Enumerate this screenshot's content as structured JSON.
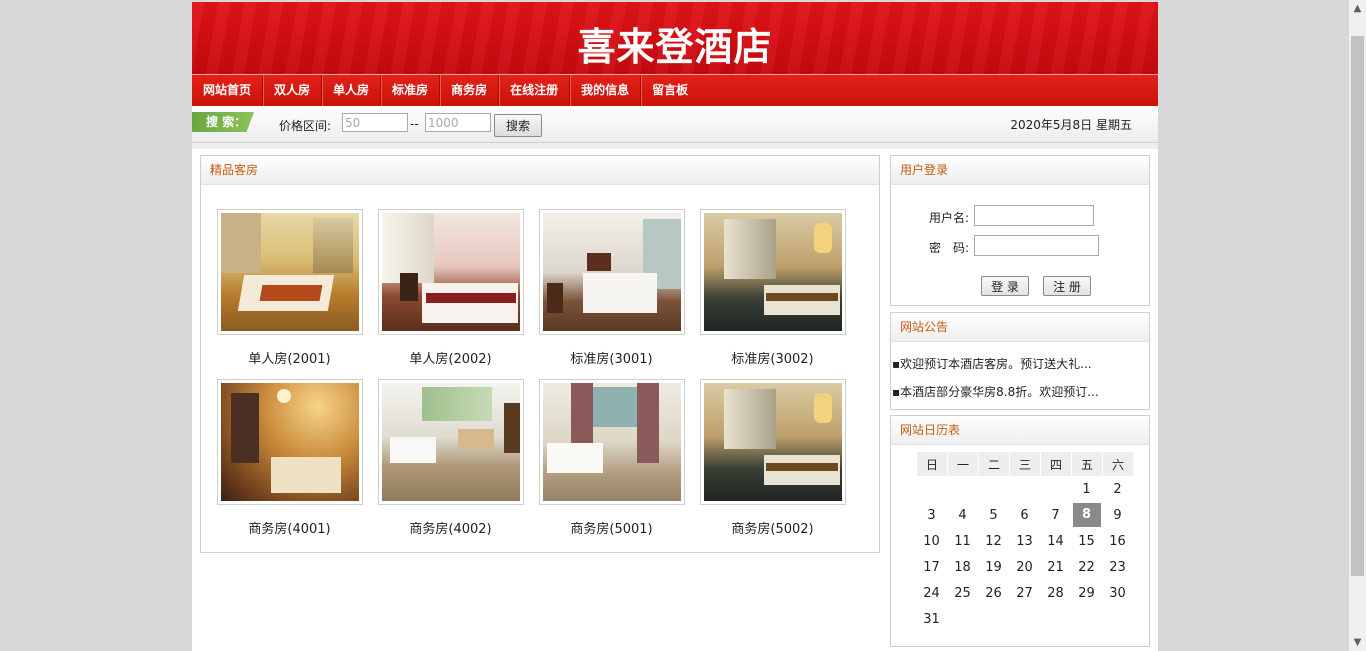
{
  "site": {
    "title": "喜来登酒店"
  },
  "nav": {
    "items": [
      {
        "label": "网站首页"
      },
      {
        "label": "双人房"
      },
      {
        "label": "单人房"
      },
      {
        "label": "标准房"
      },
      {
        "label": "商务房"
      },
      {
        "label": "在线注册"
      },
      {
        "label": "我的信息"
      },
      {
        "label": "留言板"
      }
    ]
  },
  "search": {
    "tag": "搜 索：",
    "price_label": "价格区间:",
    "min_placeholder": "50",
    "max_placeholder": "1000",
    "separator": "--",
    "button": "搜索",
    "date": "2020年5月8日 星期五"
  },
  "rooms": {
    "title": "精品客房",
    "items": [
      {
        "name": "单人房(2001)",
        "image": "warm-hotel-room-photo"
      },
      {
        "name": "单人房(2002)",
        "image": "pink-hotel-room-photo"
      },
      {
        "name": "标准房(3001)",
        "image": "standard-hotel-room-photo"
      },
      {
        "name": "标准房(3002)",
        "image": "dark-hotel-room-photo"
      },
      {
        "name": "商务房(4001)",
        "image": "golden-hotel-room-photo"
      },
      {
        "name": "商务房(4002)",
        "image": "bright-hotel-room-photo"
      },
      {
        "name": "商务房(5001)",
        "image": "window-hotel-room-photo"
      },
      {
        "name": "商务房(5002)",
        "image": "dark-hotel-room-photo"
      }
    ]
  },
  "login": {
    "title": "用户登录",
    "username_label": "用户名:",
    "password_label": "密　码:",
    "login_button": "登 录",
    "register_button": "注 册"
  },
  "notice": {
    "title": "网站公告",
    "items": [
      "▪欢迎预订本酒店客房。预订送大礼...",
      "▪本酒店部分豪华房8.8折。欢迎预订..."
    ]
  },
  "calendar": {
    "title": "网站日历表",
    "weekdays": [
      "日",
      "一",
      "二",
      "三",
      "四",
      "五",
      "六"
    ],
    "today": 8,
    "weeks": [
      [
        "",
        "",
        "",
        "",
        "",
        "1",
        "2"
      ],
      [
        "3",
        "4",
        "5",
        "6",
        "7",
        "8",
        "9"
      ],
      [
        "10",
        "11",
        "12",
        "13",
        "14",
        "15",
        "16"
      ],
      [
        "17",
        "18",
        "19",
        "20",
        "21",
        "22",
        "23"
      ],
      [
        "24",
        "25",
        "26",
        "27",
        "28",
        "29",
        "30"
      ],
      [
        "31",
        "",
        "",
        "",
        "",
        "",
        ""
      ]
    ]
  },
  "colors": {
    "brand_red": "#d30d12",
    "search_green": "#6aa640",
    "section_title": "#c85a12"
  }
}
